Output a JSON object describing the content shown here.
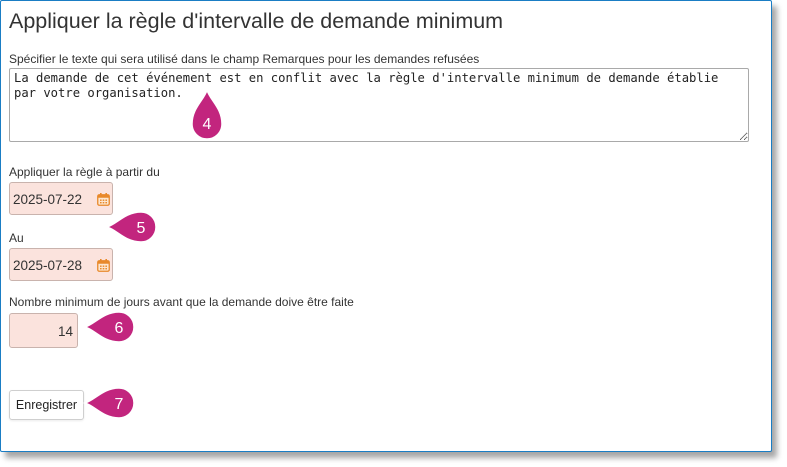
{
  "page": {
    "title": "Appliquer la règle d'intervalle de demande minimum",
    "remarks_label": "Spécifier le texte qui sera utilisé dans le champ Remarques pour les demandes refusées",
    "remarks_value": "La demande de cet événement est en conflit avec la règle d'intervalle minimum de demande établie par votre organisation.",
    "start_label": "Appliquer la règle à partir du",
    "start_value": "2025-07-22",
    "end_label": "Au",
    "end_value": "2025-07-28",
    "min_days_label": "Nombre minimum de jours avant que la demande doive être faite",
    "min_days_value": "14",
    "save_label": "Enregistrer"
  },
  "callouts": [
    "4",
    "5",
    "6",
    "7"
  ],
  "colors": {
    "accent_border": "#1a7dc4",
    "callout": "#c2257e",
    "field_fill": "#fbe3dd",
    "calendar_icon": "#e8892a"
  },
  "icons": [
    "calendar-icon"
  ]
}
